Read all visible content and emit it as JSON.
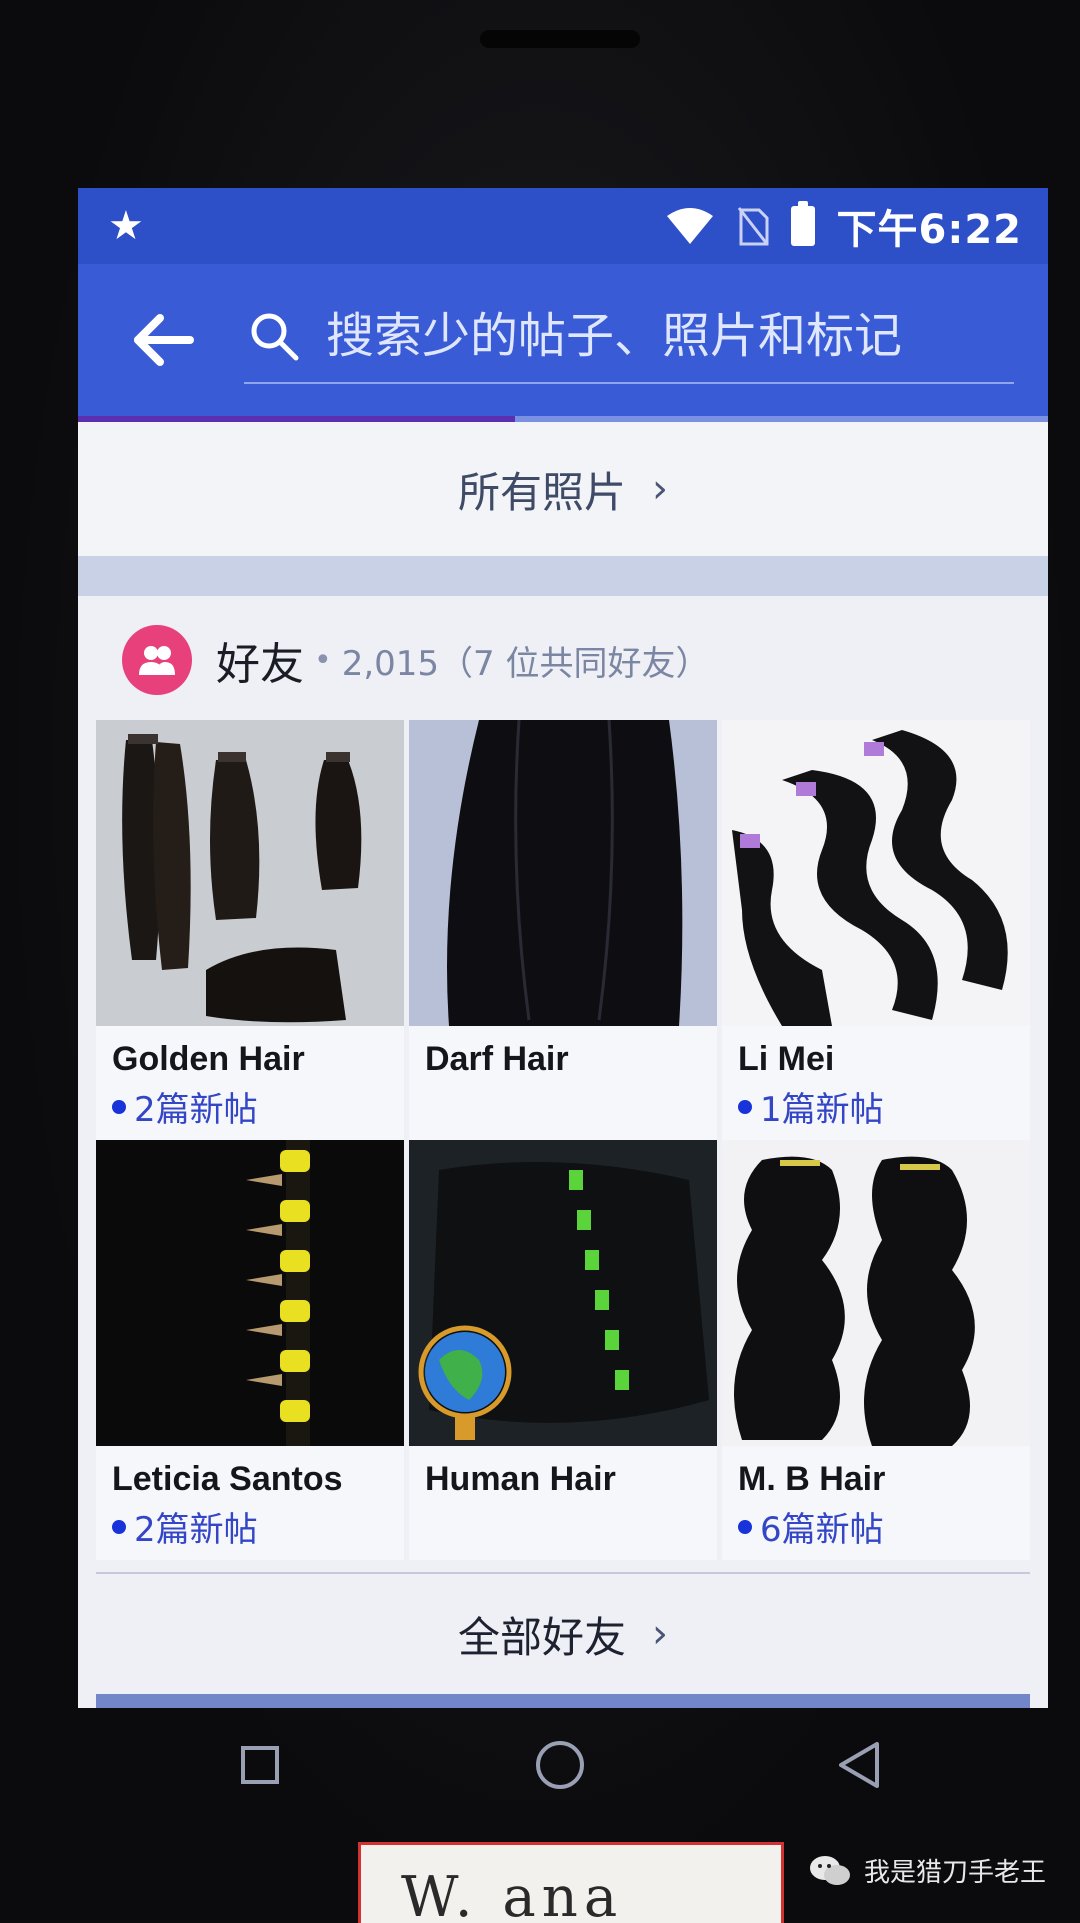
{
  "status_bar": {
    "time": "下午6:22"
  },
  "search": {
    "placeholder": "搜索少的帖子、照片和标记",
    "progress_fraction": 0.45
  },
  "all_photos": {
    "label": "所有照片",
    "chevron": "›"
  },
  "friends": {
    "title": "好友",
    "separator": "•",
    "count_text": "2,015（7 位共同好友）",
    "items": [
      {
        "name": "Golden Hair",
        "new_posts": "2篇新帖",
        "photo": "bundles"
      },
      {
        "name": "Darf Hair",
        "new_posts": "",
        "photo": "straight"
      },
      {
        "name": "Li Mei",
        "new_posts": "1篇新帖",
        "photo": "bodywave"
      },
      {
        "name": "Leticia Santos",
        "new_posts": "2篇新帖",
        "photo": "wefts"
      },
      {
        "name": "Human Hair",
        "new_posts": "",
        "photo": "globe"
      },
      {
        "name": "M. B Hair",
        "new_posts": "6篇新帖",
        "photo": "curly"
      }
    ],
    "all_friends_label": "全部好友",
    "all_friends_chevron": "›"
  },
  "watermark": {
    "text": "我是猎刀手老王"
  },
  "sticker": {
    "text": "W. ana"
  },
  "colors": {
    "header_blue": "#3a5bd6",
    "status_blue": "#2d4fc7",
    "friends_icon_pink": "#e8407a",
    "new_post_dot": "#1733d9"
  },
  "icons": [
    "star-icon",
    "wifi-icon",
    "no-sim-icon",
    "battery-icon",
    "back-arrow-icon",
    "search-icon",
    "friends-icon",
    "chevron-right-icon",
    "nav-recents-icon",
    "nav-home-icon",
    "nav-back-icon",
    "wechat-icon"
  ]
}
